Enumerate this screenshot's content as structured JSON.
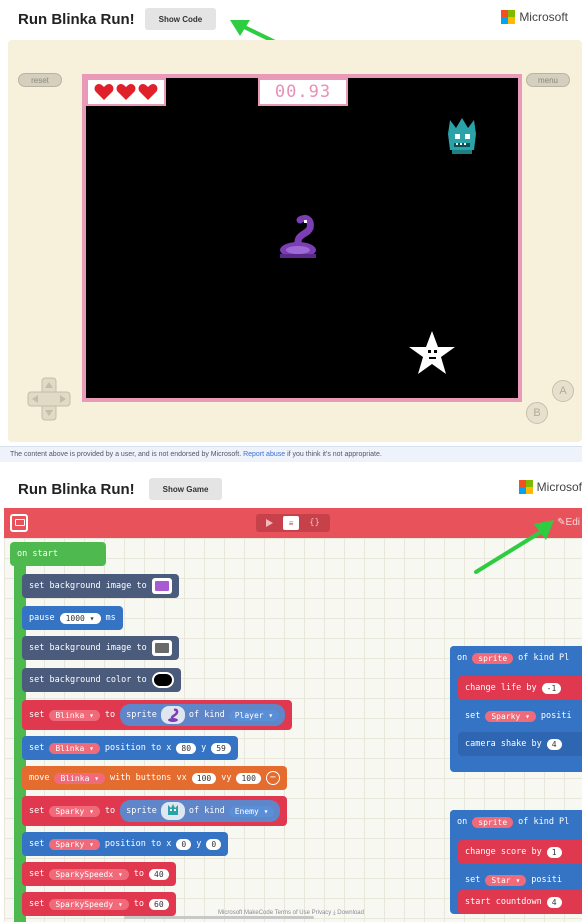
{
  "top": {
    "title": "Run Blinka Run!",
    "show_code_label": "Show Code",
    "brand": "Microsoft",
    "reset_label": "reset",
    "menu_label": "menu",
    "timer": "00.93",
    "lives": 3,
    "button_a": "A",
    "button_b": "B",
    "disclaimer_text": "The content above is provided by a user, and is not endorsed by Microsoft.",
    "report_link": "Report abuse",
    "disclaimer_tail": "if you think it's not appropriate."
  },
  "bottom": {
    "title": "Run Blinka Run!",
    "show_game_label": "Show Game",
    "brand": "Microsof",
    "toggle_blocks": "≡",
    "toggle_js": "{}",
    "edit_label": "Edi",
    "footer": "Microsoft MakeCode  Terms of Use  Privacy  ⤓ Download",
    "blocks": {
      "on_start": "on start",
      "set_bg_image_to": "set background image to",
      "pause": "pause",
      "pause_value": "1000 ▾",
      "ms": "ms",
      "set_bg_color_to": "set background color to",
      "set": "set",
      "blinka_var": "Blinka ▾",
      "to": "to",
      "sprite": "sprite",
      "of_kind": "of kind",
      "player_kind": "Player ▾",
      "position_to_x": "position to x",
      "blinka_x": "80",
      "y": "y",
      "blinka_y": "59",
      "move": "move",
      "with_buttons_vx": "with buttons vx",
      "vx_value": "100",
      "vy": "vy",
      "vy_value": "100",
      "sparky_var": "Sparky ▾",
      "enemy_kind": "Enemy ▾",
      "sparky_x": "0",
      "sparky_y": "0",
      "sparkyspeedx_var": "SparkySpeedx ▾",
      "speedx_value": "40",
      "sparkyspeedy_var": "SparkySpeedy ▾",
      "speedy_value": "60",
      "on": "on",
      "of_kind_trunc": "of kind",
      "pl_trunc": "Pl",
      "change_life_by": "change life by",
      "life_value": "-1",
      "sparky_trunc": "Sparky ▾",
      "positi_trunc": "positi",
      "camera_shake_by": "camera shake by",
      "shake_value": "4",
      "change_score_by": "change score by",
      "score_value": "1",
      "star_var": "Star ▾",
      "start_countdown": "start countdown",
      "countdown_value": "4"
    }
  },
  "colors": {
    "console_bg": "#f7f1dc",
    "screen_border": "#e99ab9",
    "editor_bar": "#e8525a",
    "block_green": "#4eb94e",
    "block_red": "#e0384e",
    "block_blue": "#3574c4",
    "arrow_green": "#2ecc40"
  }
}
